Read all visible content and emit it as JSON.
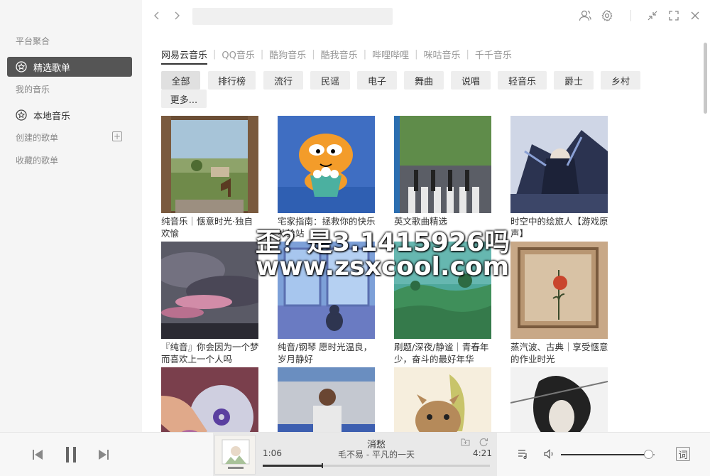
{
  "sidebar": {
    "platform_heading": "平台聚合",
    "featured_label": "精选歌单",
    "my_music_heading": "我的音乐",
    "local_music_label": "本地音乐",
    "created_playlists_label": "创建的歌单",
    "collected_playlists_label": "收藏的歌单"
  },
  "search": {
    "value": "",
    "placeholder": ""
  },
  "platforms": [
    "网易云音乐",
    "QQ音乐",
    "酷狗音乐",
    "酷我音乐",
    "哔哩哔哩",
    "咪咕音乐",
    "千千音乐"
  ],
  "active_platform": 0,
  "tags": [
    "全部",
    "排行榜",
    "流行",
    "民谣",
    "电子",
    "舞曲",
    "说唱",
    "轻音乐",
    "爵士",
    "乡村",
    "更多..."
  ],
  "active_tag": 0,
  "playlists": [
    {
      "title": "纯音乐｜惬意时光·独自欢愉",
      "cover": "window-villa"
    },
    {
      "title": "宅家指南：拯救你的快乐补给站",
      "cover": "garfield-popcorn"
    },
    {
      "title": "英文歌曲精选",
      "cover": "abbey-road"
    },
    {
      "title": "时空中的绘旅人【游戏原声】",
      "cover": "anime-night"
    },
    {
      "title": "『纯音』你会因为一个梦而喜欢上一个人吗",
      "cover": "pink-clouds"
    },
    {
      "title": "纯音/钢琴 愿时光温良，岁月静好",
      "cover": "cat-window"
    },
    {
      "title": "刷题/深夜/静谧｜青春年少，奋斗的最好年华",
      "cover": "green-field"
    },
    {
      "title": "蒸汽波、古典｜享受惬意的作业时光",
      "cover": "rose-window"
    },
    {
      "title": "",
      "cover": "hand-records"
    },
    {
      "title": "",
      "cover": "basketball-court"
    },
    {
      "title": "",
      "cover": "cartoon-cat"
    },
    {
      "title": "",
      "cover": "anime-sketch"
    }
  ],
  "watermark": {
    "line1": "歪？是3.1415926吗",
    "line2": "www.zsxcool.com"
  },
  "player": {
    "song": "消愁",
    "artist_album": "毛不易 - 平凡的一天",
    "current_time": "1:06",
    "total_time": "4:21",
    "progress": 0.26,
    "volume": 0.93,
    "lyrics_label": "词"
  },
  "colors": {
    "active_bg": "#555555",
    "sidebar_bg": "#f5f5f5",
    "chip_bg": "#eeeeee"
  }
}
